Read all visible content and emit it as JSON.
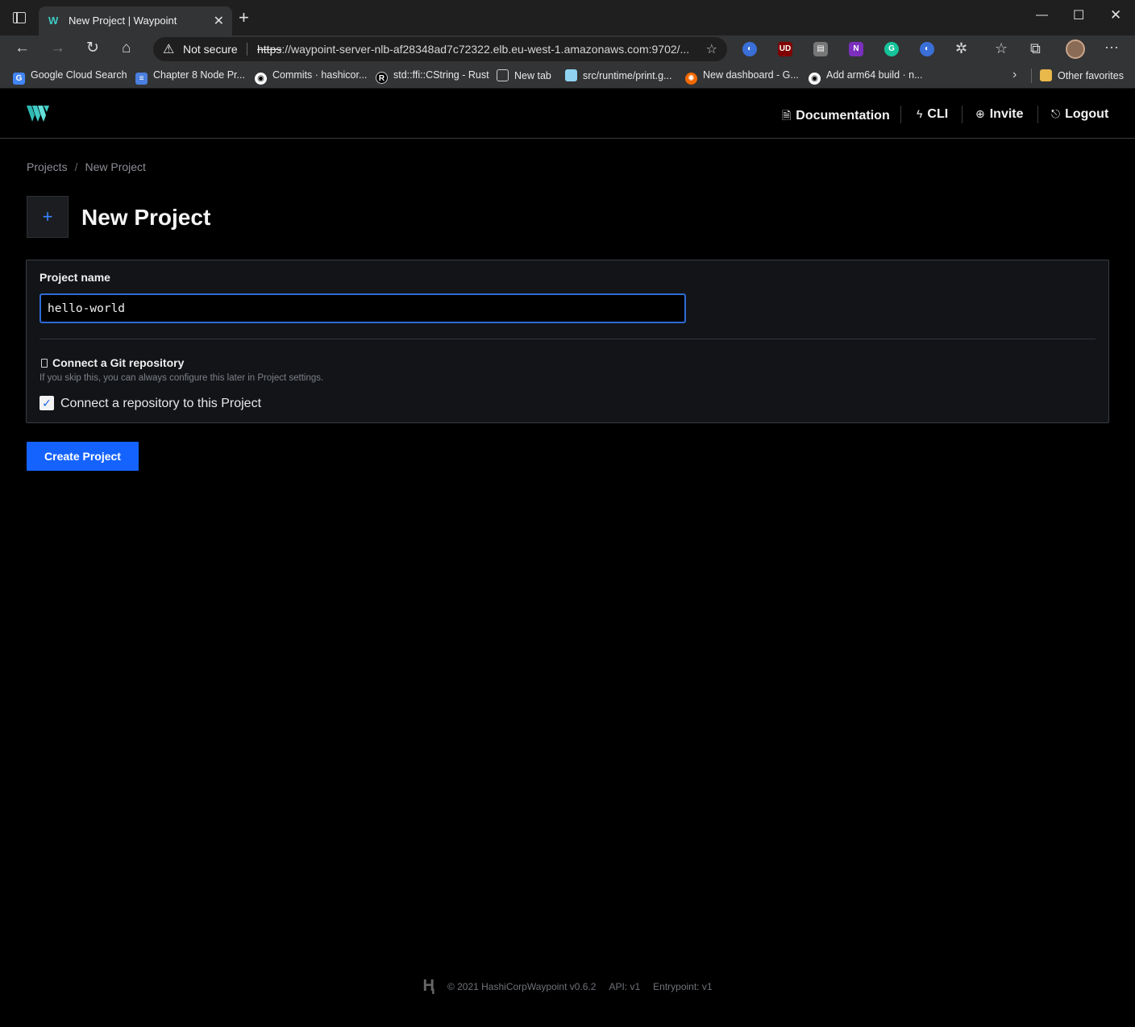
{
  "browser": {
    "tab_title": "New Project | Waypoint",
    "security_label": "Not secure",
    "url_scheme": "https",
    "url_rest": "://waypoint-server-nlb-af28348ad7c72322.elb.eu-west-1.amazonaws.com:9702/...",
    "bookmarks": [
      "Google Cloud Search",
      "Chapter 8 Node Pr...",
      "Commits · hashicor...",
      "std::ffi::CString - Rust",
      "New tab",
      "src/runtime/print.g...",
      "New dashboard - G...",
      "Add arm64 build · n..."
    ],
    "other_favorites": "Other favorites",
    "extensions": [
      "UD",
      "N",
      "G"
    ]
  },
  "header": {
    "nav": {
      "documentation": "Documentation",
      "cli": "CLI",
      "invite": "Invite",
      "logout": "Logout"
    }
  },
  "breadcrumb": {
    "root": "Projects",
    "separator": "/",
    "current": "New Project"
  },
  "page": {
    "title": "New Project",
    "icon": "plus-icon"
  },
  "form": {
    "project_name_label": "Project name",
    "project_name_value": "hello-world",
    "git_title": "Connect a Git repository",
    "git_hint": "If you skip this, you can always configure this later in Project settings.",
    "connect_checkbox_label": "Connect a repository to this Project",
    "connect_checked": true,
    "submit_label": "Create Project"
  },
  "footer": {
    "copyright": "© 2021 HashiCorp",
    "version": "Waypoint v0.6.2",
    "api": "API: v1",
    "entrypoint": "Entrypoint: v1"
  },
  "colors": {
    "accent": "#1563ff",
    "background": "#000000",
    "card": "#121418",
    "logo": "#3fc9c4"
  }
}
